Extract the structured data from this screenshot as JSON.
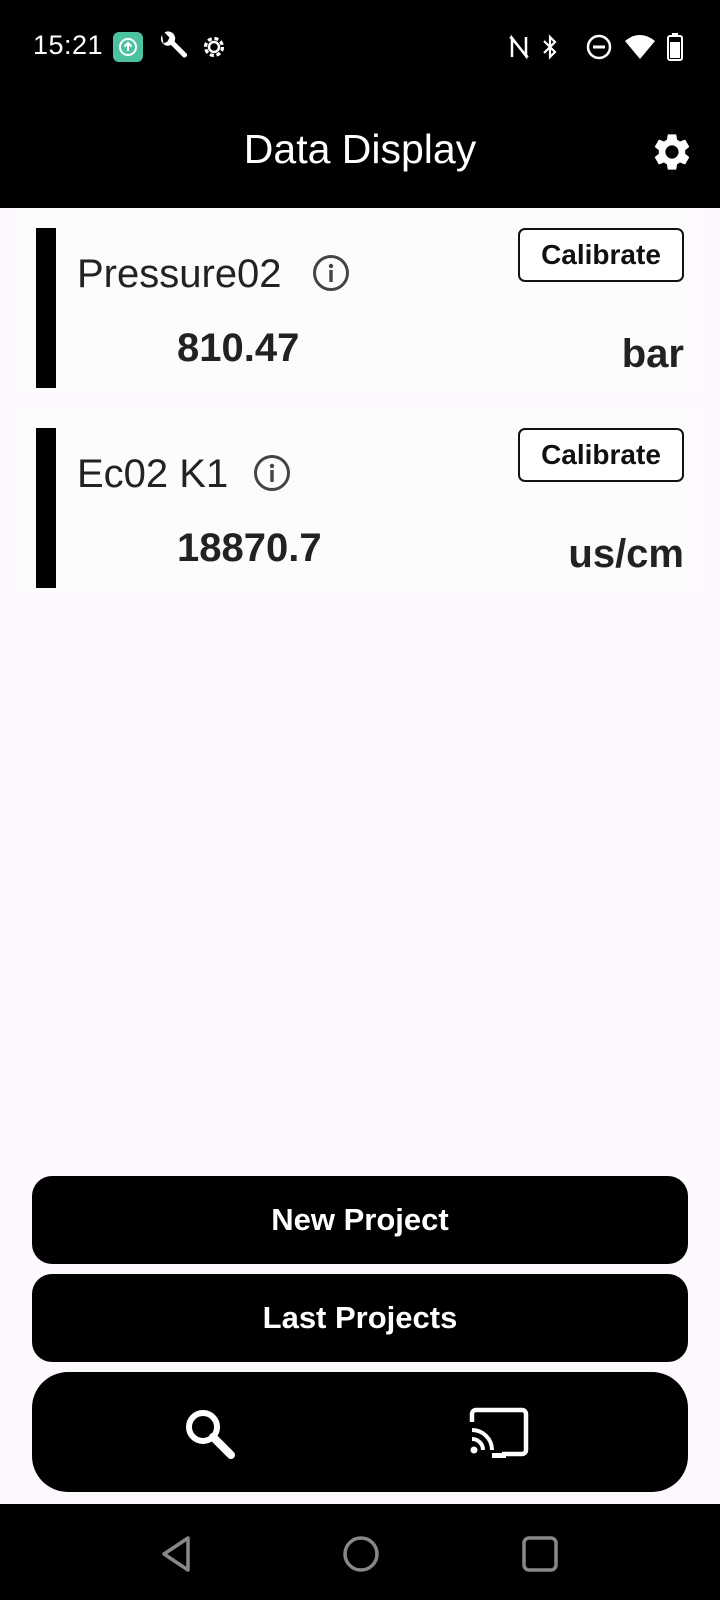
{
  "status_bar": {
    "time": "15:21",
    "icons": [
      "upload-app-icon",
      "wrench-icon",
      "settings-icon",
      "nfc-icon",
      "bluetooth-icon",
      "do-not-disturb-icon",
      "wifi-icon",
      "battery-icon"
    ]
  },
  "app_bar": {
    "title": "Data Display",
    "settings_icon": "gear-icon"
  },
  "sensors": [
    {
      "name": "Pressure02",
      "value": "810.47",
      "unit": "bar",
      "calibrate_label": "Calibrate"
    },
    {
      "name": "Ec02 K1",
      "value": "18870.7",
      "unit": "us/cm",
      "calibrate_label": "Calibrate"
    }
  ],
  "actions": {
    "new_project": "New Project",
    "last_projects": "Last Projects"
  },
  "toolbar": {
    "icons": [
      "search-icon",
      "cast-icon"
    ]
  },
  "nav": {
    "icons": [
      "back-icon",
      "home-icon",
      "recents-icon"
    ]
  },
  "colors": {
    "background": "#fdf8fd",
    "bars": "#000000",
    "text": "#222222"
  }
}
